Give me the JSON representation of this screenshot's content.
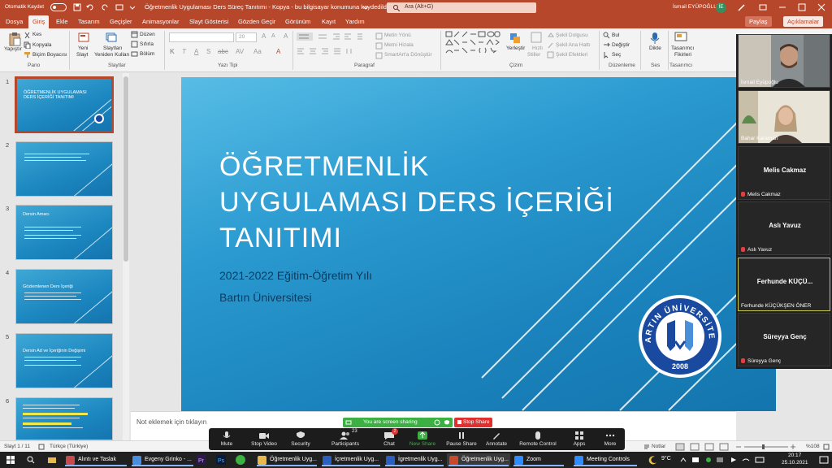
{
  "titlebar": {
    "autosave_label": "Otomatik Kaydet",
    "document_title": "Öğretmenlik Uygulaması Ders Süreç Tanıtımı - Kopya  -  bu bilgisayar konumuna kaydedildi",
    "search_placeholder": "Ara (Alt+G)",
    "user_name": "İsmail EYÜPOĞLU",
    "user_initials": "İE"
  },
  "menu": {
    "items": [
      "Dosya",
      "Giriş",
      "Ekle",
      "Tasarım",
      "Geçişler",
      "Animasyonlar",
      "Slayt Gösterisi",
      "Gözden Geçir",
      "Görünüm",
      "Kayıt",
      "Yardım"
    ],
    "share_label": "Paylaş",
    "comments_label": "Açıklamalar"
  },
  "ribbon": {
    "paste": "Yapıştır",
    "cut": "Kes",
    "copy": "Kopyala",
    "format_painter": "Biçim Boyacısı",
    "new_slide_1": "Yeni",
    "new_slide_2": "Slayt",
    "reuse_1": "Slaytları",
    "reuse_2": "Yeniden Kullan",
    "layout": "Düzen",
    "reset": "Sıfırla",
    "section": "Bölüm",
    "font_size": "20",
    "text_direction": "Metin Yönü",
    "align_text": "Metni Hizala",
    "smartart": "SmartArt'a Dönüştür",
    "arrange": "Yerleştir",
    "quick_styles_1": "Hızlı",
    "quick_styles_2": "Stiller",
    "shape_fill": "Şekil Dolgusu",
    "shape_outline": "Şekil Ana Hattı",
    "shape_effects": "Şekil Efektleri",
    "find": "Bul",
    "replace": "Değiştir",
    "select": "Seç",
    "dictate": "Dikte",
    "designer_1": "Tasarımcı",
    "designer_2": "Fikirleri",
    "groups": [
      "Pano",
      "Slaytlar",
      "Yazı Tipi",
      "Paragraf",
      "Çizim",
      "Düzenleme",
      "Ses",
      "Tasarımcı"
    ]
  },
  "thumbnails": [
    {
      "num": "1",
      "title": "ÖĞRETMENLİK UYGULAMASI DERS İÇERİĞİ TANITIMI"
    },
    {
      "num": "2",
      "title": ""
    },
    {
      "num": "3",
      "title": "Dersin Amacı"
    },
    {
      "num": "4",
      "title": "Gözlemlenen Ders İçeriği"
    },
    {
      "num": "5",
      "title": "Dersin Ad ve İçeriğinin Değişimi"
    },
    {
      "num": "6",
      "title": ""
    }
  ],
  "slide": {
    "title": "ÖĞRETMENLİK\nUYGULAMASI DERS İÇERİĞİ\nTANITIMI",
    "subtitle_1": "2021-2022 Eğitim-Öğretim Yılı",
    "subtitle_2": "Bartın Üniversitesi",
    "logo_text": "BARTIN ÜNİVERSİTESİ",
    "logo_year": "2008"
  },
  "notes_placeholder": "Not eklemek için tıklayın",
  "participants": [
    {
      "name": "İsmail Eyüpoğlu",
      "video": true
    },
    {
      "name": "Bahar Karaman",
      "video": true
    },
    {
      "name": "Melis Cakmaz",
      "display": "Melis Cakmaz",
      "video": false
    },
    {
      "name": "Aslı Yavuz",
      "display": "Aslı Yavuz",
      "video": false
    },
    {
      "name": "Ferhunde KÜÇÜKŞEN ÖNER",
      "display": "Ferhunde  KÜÇÜ...",
      "video": false
    },
    {
      "name": "Süreyya Genç",
      "display": "Süreyya Genç",
      "video": false
    }
  ],
  "status": {
    "slide_count": "Slayt 1 / 11",
    "language": "Türkçe (Türkiye)",
    "notes": "Notlar",
    "zoom": "%108"
  },
  "zoom_toolbar": {
    "sharing_banner": "You are screen sharing",
    "stop_share": "Stop Share",
    "participants_count": "23",
    "chat_badge": "2",
    "buttons": [
      "Mute",
      "Stop Video",
      "Security",
      "Participants",
      "Chat",
      "New Share",
      "Pause Share",
      "Annotate",
      "Remote Control",
      "Apps",
      "More"
    ]
  },
  "taskbar": {
    "items": [
      "Alıntı ve Taslak",
      "Evgeny Grinko - ...",
      "Öğretmenlik Uyg...",
      "İçretmenlik Uyg...",
      "İgretmenlik Uyg...",
      "Öğretmenlik Uyg...",
      "Zoom",
      "Meeting Controls"
    ],
    "weather": "9°C",
    "time": "20:17",
    "date": "25.10.2021"
  }
}
